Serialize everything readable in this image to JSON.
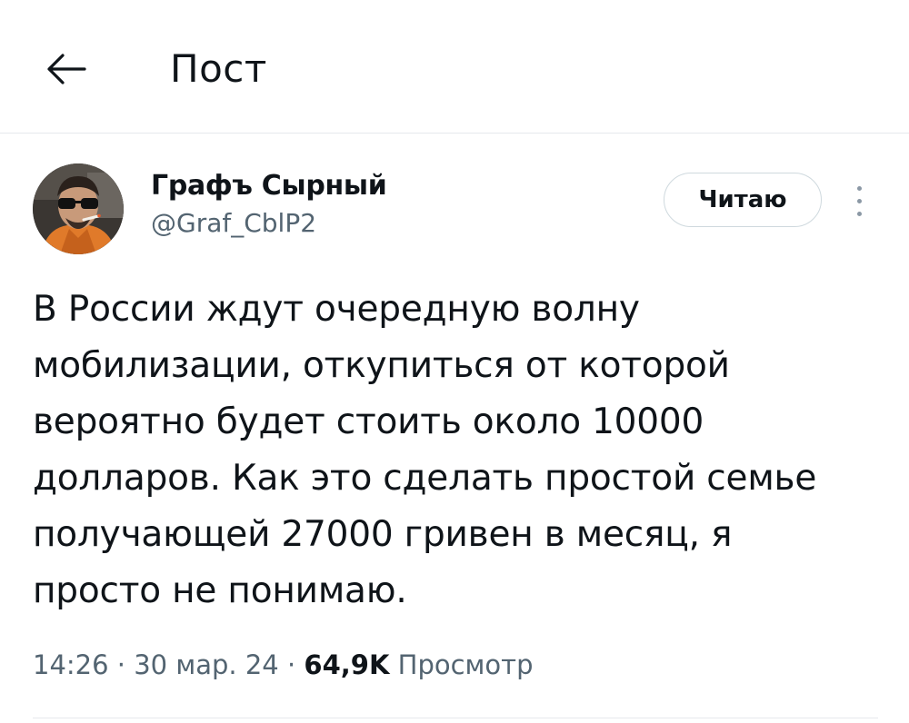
{
  "header": {
    "title": "Пост",
    "back_icon": "arrow-left-icon"
  },
  "author": {
    "name": "Графъ Сырный",
    "handle": "@Graf_CblP2",
    "avatar_icon": "avatar-photo"
  },
  "follow_button": {
    "label": "Читаю"
  },
  "more_button": {
    "icon": "more-vertical-icon"
  },
  "post": {
    "text": "В России ждут очередную волну\nмобилизации, откупиться от которой\nвероятно будет стоить около 10000\nдолларов. Как это сделать простой семье\nполучающей 27000 гривен в месяц, я\nпросто не понимаю."
  },
  "meta": {
    "time": "14:26",
    "separator": " · ",
    "date": "30 мар. 24",
    "views_count": "64,9K",
    "views_label": "Просмотр"
  },
  "colors": {
    "text_primary": "#0f1419",
    "text_secondary": "#536471",
    "divider": "#e6e9ec",
    "button_border": "#cfd9de"
  }
}
